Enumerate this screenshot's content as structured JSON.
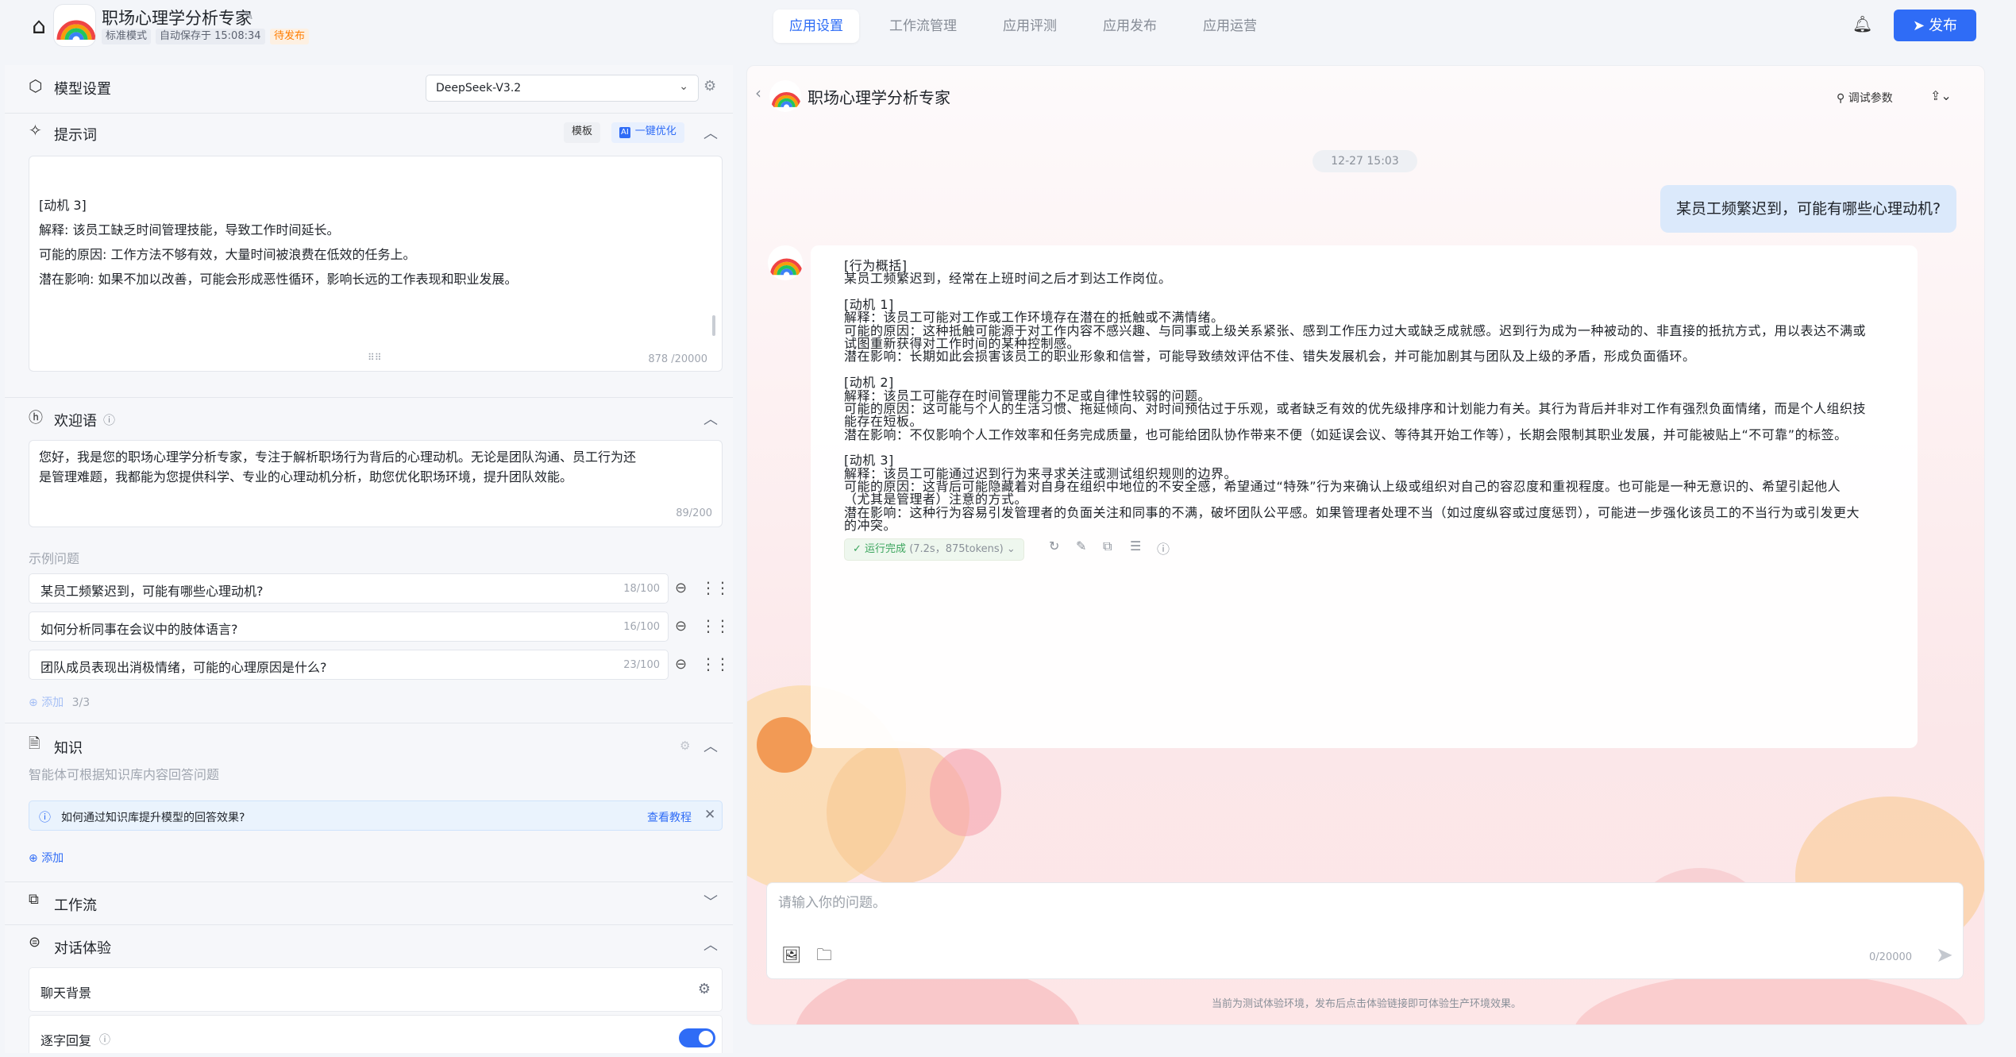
{
  "app": {
    "title": "职场心理学分析专家",
    "tags": [
      "标准模式",
      "自动保存于 15:08:34",
      "待发布"
    ]
  },
  "nav": {
    "tabs": [
      "应用设置",
      "工作流管理",
      "应用评测",
      "应用发布",
      "应用运营"
    ],
    "publish_label": "发布"
  },
  "model": {
    "label": "模型设置",
    "selected": "DeepSeek-V3.2"
  },
  "prompt": {
    "label": "提示词",
    "template_btn": "模板",
    "optimize_btn": "一键优化",
    "lines": [
      "[动机 3]",
      "解释: 该员工缺乏时间管理技能，导致工作时间延长。",
      "可能的原因: 工作方法不够有效，大量时间被浪费在低效的任务上。",
      "潜在影响: 如果不加以改善，可能会形成恶性循环，影响长远的工作表现和职业发展。"
    ],
    "count": "878 /20000"
  },
  "welcome": {
    "label": "欢迎语",
    "text_lines": [
      "您好，我是您的职场心理学分析专家，专注于解析职场行为背后的心理动机。无论是团队沟通、员工行为还",
      "是管理难题，我都能为您提供科学、专业的心理动机分析，助您优化职场环境，提升团队效能。"
    ],
    "count": "89/200"
  },
  "examples": {
    "label": "示例问题",
    "items": [
      {
        "text": "某员工频繁迟到，可能有哪些心理动机?",
        "count": "18/100"
      },
      {
        "text": "如何分析同事在会议中的肢体语言?",
        "count": "16/100"
      },
      {
        "text": "团队成员表现出消极情绪，可能的心理原因是什么?",
        "count": "23/100"
      }
    ],
    "add_label": "添加",
    "add_count": "3/3"
  },
  "knowledge": {
    "label": "知识",
    "desc": "智能体可根据知识库内容回答问题",
    "tip": "如何通过知识库提升模型的回答效果?",
    "tip_link": "查看教程",
    "add_label": "添加"
  },
  "workflow": {
    "label": "工作流"
  },
  "dialog": {
    "label": "对话体验",
    "bg_label": "聊天背景",
    "stream_label": "逐字回复"
  },
  "chat": {
    "title": "职场心理学分析专家",
    "debug_label": "调试参数",
    "timestamp": "12-27 15:03",
    "user_msg": "某员工频繁迟到，可能有哪些心理动机?",
    "reply_lines": [
      "[行为概括]",
      "某员工频繁迟到，经常在上班时间之后才到达工作岗位。",
      "",
      "[动机 1]",
      "解释：该员工可能对工作或工作环境存在潜在的抵触或不满情绪。",
      "可能的原因：这种抵触可能源于对工作内容不感兴趣、与同事或上级关系紧张、感到工作压力过大或缺乏成就感。迟到行为成为一种被动的、非直接的抵抗方式，用以表达不满或",
      "试图重新获得对工作时间的某种控制感。",
      "潜在影响：长期如此会损害该员工的职业形象和信誉，可能导致绩效评估不佳、错失发展机会，并可能加剧其与团队及上级的矛盾，形成负面循环。",
      "",
      "[动机 2]",
      "解释：该员工可能存在时间管理能力不足或自律性较弱的问题。",
      "可能的原因：这可能与个人的生活习惯、拖延倾向、对时间预估过于乐观，或者缺乏有效的优先级排序和计划能力有关。其行为背后并非对工作有强烈负面情绪，而是个人组织技",
      "能存在短板。",
      "潜在影响：不仅影响个人工作效率和任务完成质量，也可能给团队协作带来不便（如延误会议、等待其开始工作等），长期会限制其职业发展，并可能被贴上“不可靠”的标签。",
      "",
      "[动机 3]",
      "解释：该员工可能通过迟到行为来寻求关注或测试组织规则的边界。",
      "可能的原因：这背后可能隐藏着对自身在组织中地位的不安全感，希望通过“特殊”行为来确认上级或组织对自己的容忍度和重视程度。也可能是一种无意识的、希望引起他人",
      "（尤其是管理者）注意的方式。",
      "潜在影响：这种行为容易引发管理者的负面关注和同事的不满，破坏团队公平感。如果管理者处理不当（如过度纵容或过度惩罚），可能进一步强化该员工的不当行为或引发更大",
      "的冲突。"
    ],
    "status_label": "运行完成",
    "status_meta": "(7.2s，875tokens)",
    "input_placeholder": "请输入你的问题。",
    "input_count": "0/20000",
    "footnote": "当前为测试体验环境，发布后点击体验链接即可体验生产环境效果。"
  },
  "colors": {
    "accent": "#2f6cf6",
    "success": "#3ba55d",
    "warning": "#ff7d00"
  }
}
